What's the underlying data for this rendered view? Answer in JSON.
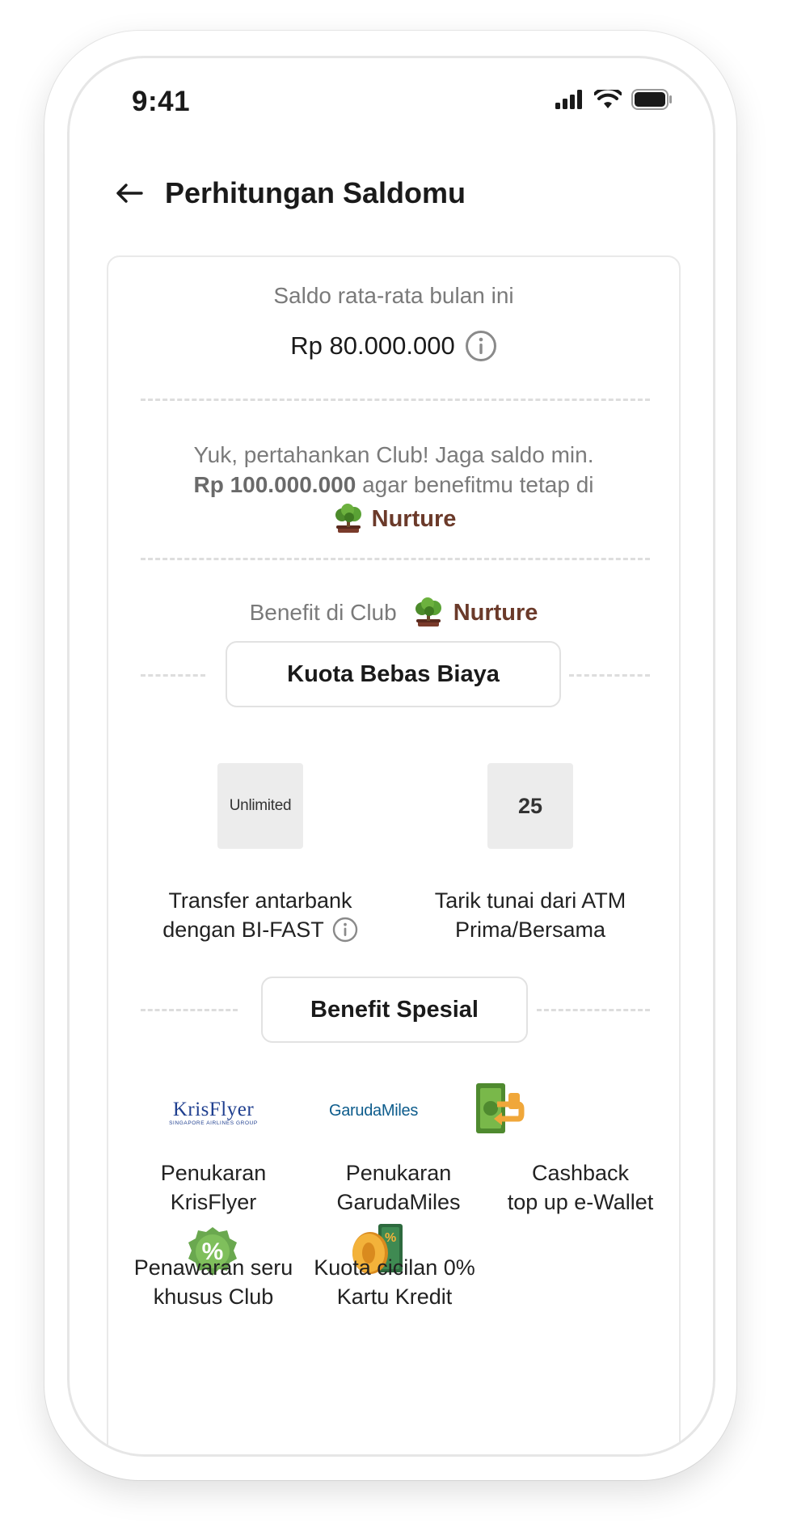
{
  "status_bar": {
    "time": "9:41"
  },
  "header": {
    "title": "Perhitungan Saldomu"
  },
  "balance": {
    "label": "Saldo rata-rata bulan ini",
    "amount": "Rp 80.000.000"
  },
  "message": {
    "line1": "Yuk, pertahankan Club! Jaga saldo min.",
    "min_amount": "Rp 100.000.000",
    "line2_rest": "agar benefitmu tetap di",
    "tier": "Nurture"
  },
  "benefit_header": {
    "label": "Benefit di Club",
    "tier": "Nurture"
  },
  "quota_section": {
    "title": "Kuota Bebas Biaya",
    "items": [
      {
        "value": "Unlimited",
        "label_line1": "Transfer antarbank",
        "label_line2": "dengan BI-FAST"
      },
      {
        "value": "25",
        "label_line1": "Tarik tunai dari ATM",
        "label_line2": "Prima/Bersama"
      }
    ]
  },
  "special_section": {
    "title": "Benefit Spesial",
    "items": [
      {
        "logo_text": "KrisFlyer",
        "logo_sub": "SINGAPORE AIRLINES GROUP",
        "label_line1": "Penukaran",
        "label_line2": "KrisFlyer"
      },
      {
        "logo_text": "GarudaMiles",
        "label_line1": "Penukaran",
        "label_line2": "GarudaMiles"
      },
      {
        "icon": "cashback-wallet-icon",
        "label_line1": "Cashback",
        "label_line2": "top up e-Wallet"
      },
      {
        "icon": "percent-badge-icon",
        "icon_text": "%",
        "label_line1": "Penawaran seru",
        "label_line2": "khusus Club"
      },
      {
        "icon": "zero-percent-card-icon",
        "icon_text": "0",
        "label_line1": "Kuota cicilan 0%",
        "label_line2": "Kartu Kredit"
      }
    ]
  },
  "colors": {
    "tier_brown": "#6b3a2a",
    "muted_text": "#7a7a7a",
    "krisflyer_blue": "#1f3f8f",
    "garuda_blue": "#0d5c8c",
    "green": "#6aa84f"
  }
}
